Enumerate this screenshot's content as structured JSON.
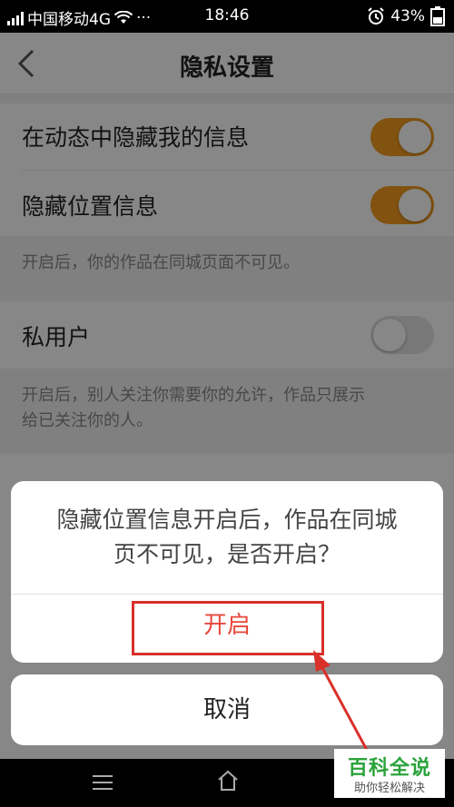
{
  "status_bar": {
    "carrier": "中国移动4G",
    "dots": "···",
    "time": "18:46",
    "battery": "43%"
  },
  "nav": {
    "title": "隐私设置"
  },
  "settings": [
    {
      "label": "在动态中隐藏我的信息",
      "enabled": true
    },
    {
      "label": "隐藏位置信息",
      "enabled": true
    },
    {
      "label": "私用户",
      "enabled": false
    }
  ],
  "notes": {
    "location": "开启后，你的作品在同城页面不可见。",
    "private_line1": "开启后，别人关注你需要你的允许，作品只展示",
    "private_line2": "给已关注你的人。"
  },
  "dialog": {
    "message_line1": "隐藏位置信息开启后，作品在同城",
    "message_line2": "页不可见，是否开启？",
    "confirm_label": "开启",
    "cancel_label": "取消"
  },
  "watermark": {
    "title": "百科全说",
    "subtitle": "助你轻松解决"
  },
  "colors": {
    "toggle_on": "#f39c1f",
    "confirm_text": "#e8473c",
    "highlight_box": "#d9302a",
    "watermark_green": "#2aa33b"
  }
}
